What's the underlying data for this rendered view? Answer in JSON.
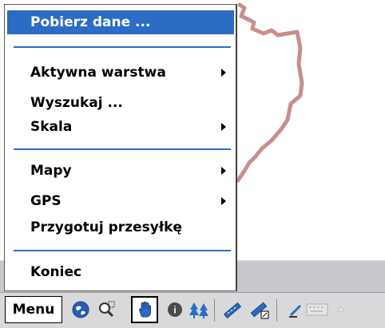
{
  "menu": {
    "items": [
      {
        "label": "Pobierz dane ...",
        "has_submenu": false,
        "highlighted": true
      },
      {
        "label": "Aktywna warstwa",
        "has_submenu": true,
        "highlighted": false
      },
      {
        "label": "Wyszukaj ...",
        "has_submenu": false,
        "highlighted": false
      },
      {
        "label": "Skala",
        "has_submenu": true,
        "highlighted": false
      },
      {
        "label": "Mapy",
        "has_submenu": true,
        "highlighted": false
      },
      {
        "label": "GPS",
        "has_submenu": true,
        "highlighted": false
      },
      {
        "label": "Przygotuj przesyłkę",
        "has_submenu": false,
        "highlighted": false
      },
      {
        "label": "Koniec",
        "has_submenu": false,
        "highlighted": false
      }
    ]
  },
  "command_bar": {
    "menu_label": "Menu",
    "icons": [
      "globe-icon",
      "zoom-search-icon",
      "hand-pan-icon",
      "info-icon",
      "trees-layer-icon",
      "ruler-measure-icon",
      "ruler-area-icon",
      "input-pen-icon",
      "keyboard-icon",
      "sip-arrow-icon"
    ],
    "pressed_icon": "hand-pan-icon"
  },
  "colors": {
    "highlight": "#2b6cc4",
    "map_line": "#c98e8e",
    "separator": "#2b6cc4"
  }
}
